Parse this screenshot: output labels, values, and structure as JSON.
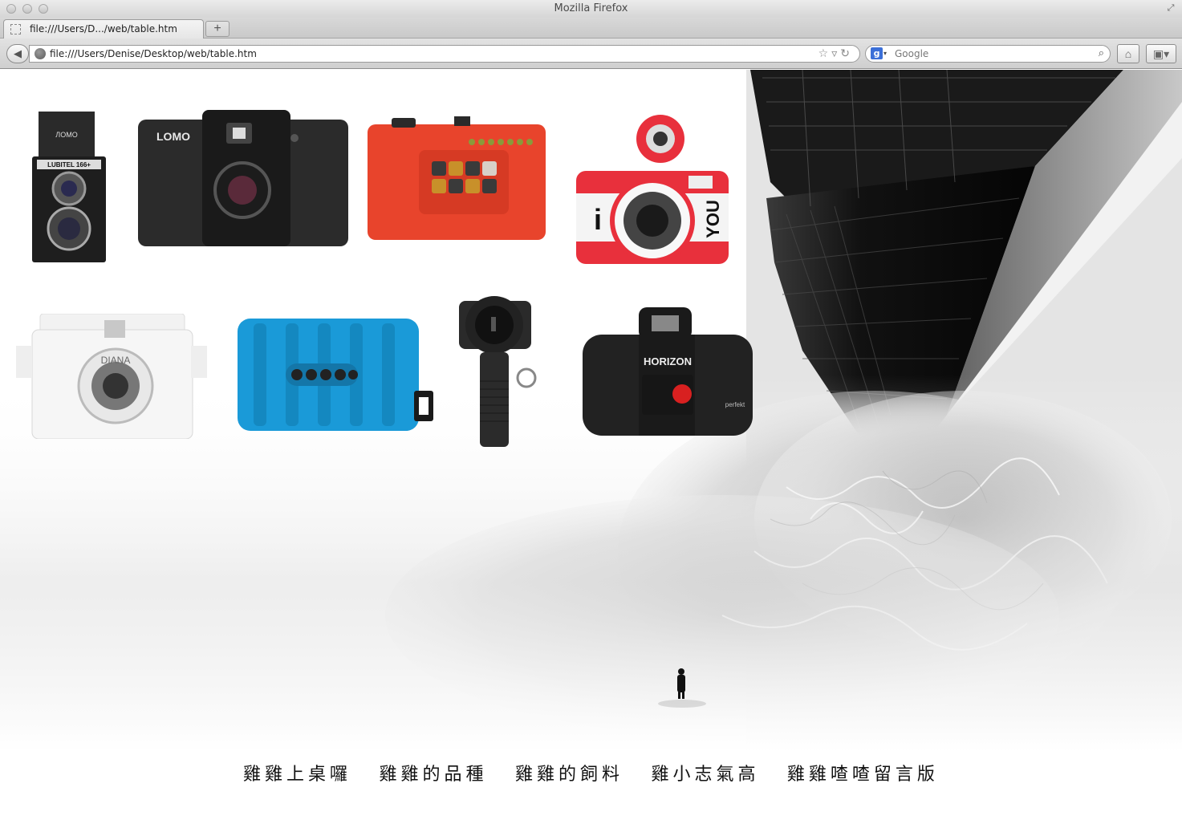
{
  "window": {
    "title": "Mozilla Firefox"
  },
  "tabs": [
    {
      "label": "file:///Users/D.../web/table.htm",
      "favicon": "blank-page-icon"
    }
  ],
  "navbar": {
    "url": "file:///Users/Denise/Desktop/web/table.htm",
    "search_engine": "Google",
    "search_placeholder": "Google"
  },
  "cameras": [
    {
      "name": "Lubitel 166+",
      "brand_text": "ЛОМО",
      "model_text": "LUBITEL 166+"
    },
    {
      "name": "LOMO LC-A",
      "brand_text": "LOMO"
    },
    {
      "name": "Orange multi-lens camera"
    },
    {
      "name": "Fisheye i-you",
      "text": "YOU"
    },
    {
      "name": "Diana Mini",
      "text": "DIANA"
    },
    {
      "name": "Blue multi-lens camera"
    },
    {
      "name": "Spinner camera"
    },
    {
      "name": "Horizon Perfekt",
      "brand_text": "HORIZON",
      "model_text": "perfekt"
    }
  ],
  "nav_links": [
    {
      "label": "雞雞上桌囉"
    },
    {
      "label": "雞雞的品種"
    },
    {
      "label": "雞雞的飼料"
    },
    {
      "label": "雞小志氣高"
    },
    {
      "label": "雞雞喳喳留言版"
    }
  ],
  "colors": {
    "orange_camera": "#e8442c",
    "blue_camera": "#1a9ad8",
    "red_fisheye": "#e8303c"
  }
}
